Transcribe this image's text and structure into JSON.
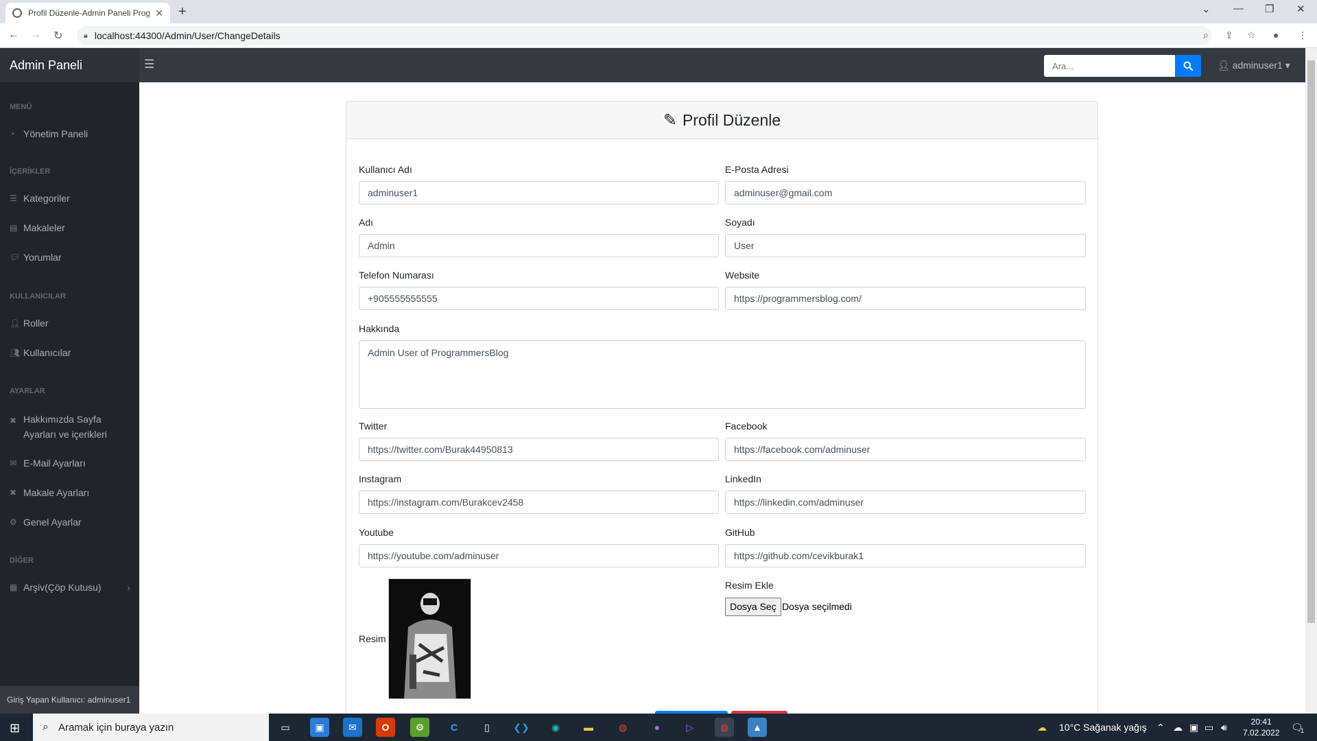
{
  "browser": {
    "tab_title": "Profil Düzenle-Admin Paneli Prog",
    "tab_close": "✕",
    "new_tab": "+",
    "url": "localhost:44300/Admin/User/ChangeDetails"
  },
  "navbar": {
    "brand": "Admin Paneli",
    "search_placeholder": "Ara...",
    "user": "adminuser1"
  },
  "sidebar": {
    "headings": [
      "MENÜ",
      "İÇERİKLER",
      "KULLANICILAR",
      "AYARLAR",
      "DİĞER"
    ],
    "items": [
      {
        "label": "Yönetim Paneli",
        "icon": "tachometer-icon"
      },
      {
        "label": "Kategoriler",
        "icon": "list-icon"
      },
      {
        "label": "Makaleler",
        "icon": "file-icon"
      },
      {
        "label": "Yorumlar",
        "icon": "comments-icon"
      },
      {
        "label": "Roller",
        "icon": "user-tag-icon"
      },
      {
        "label": "Kullanıcılar",
        "icon": "users-icon"
      },
      {
        "label": "Hakkımızda Sayfa Ayarları ve içerikleri",
        "icon": "tools-icon"
      },
      {
        "label": "E-Mail Ayarları",
        "icon": "envelope-icon"
      },
      {
        "label": "Makale Ayarları",
        "icon": "tools-icon"
      },
      {
        "label": "Genel Ayarlar",
        "icon": "gear-icon"
      },
      {
        "label": "Arşiv(Çöp Kutusu)",
        "icon": "archive-icon"
      }
    ],
    "footer": "Giriş Yapan Kullanıcı: adminuser1"
  },
  "card": {
    "title": "Profil Düzenle"
  },
  "form": {
    "username": {
      "label": "Kullanıcı Adı",
      "value": "adminuser1"
    },
    "email": {
      "label": "E-Posta Adresi",
      "value": "adminuser@gmail.com"
    },
    "first_name": {
      "label": "Adı",
      "value": "Admin"
    },
    "last_name": {
      "label": "Soyadı",
      "value": "User"
    },
    "phone": {
      "label": "Telefon Numarası",
      "value": "+905555555555"
    },
    "website": {
      "label": "Website",
      "value": "https://programmersblog.com/"
    },
    "about": {
      "label": "Hakkında",
      "value": "Admin User of ProgrammersBlog"
    },
    "twitter": {
      "label": "Twitter",
      "value": "https://twitter.com/Burak44950813"
    },
    "facebook": {
      "label": "Facebook",
      "value": "https://facebook.com/adminuser"
    },
    "instagram": {
      "label": "Instagram",
      "value": "https://instagram.com/Burakcev2458"
    },
    "linkedin": {
      "label": "LinkedIn",
      "value": "https://linkedin.com/adminuser"
    },
    "youtube": {
      "label": "Youtube",
      "value": "https://youtube.com/adminuser"
    },
    "github": {
      "label": "GitHub",
      "value": "https://github.com/cevikburak1"
    },
    "picture": {
      "label": "Resim"
    },
    "picture_upload": {
      "label": "Resim Ekle",
      "button": "Dosya Seç",
      "status": "Dosya seçilmedi"
    }
  },
  "taskbar": {
    "search_placeholder": "Aramak için buraya yazın",
    "weather": "10°C  Sağanak yağış",
    "time": "20:41",
    "date": "7.02.2022",
    "notifications": "1"
  },
  "colors": {
    "navbar": "#343a40",
    "sidebar": "#212529",
    "primary": "#007bff",
    "danger": "#dc3545"
  }
}
